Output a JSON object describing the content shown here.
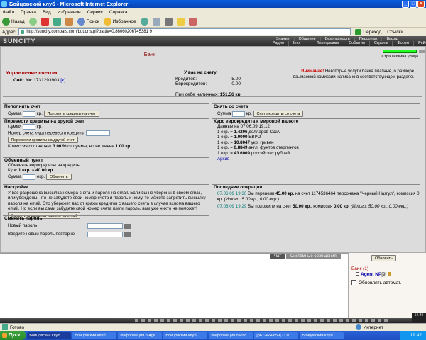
{
  "window": {
    "title": "Бойцовский клуб - Microsoft Internet Explorer"
  },
  "menu": [
    "Файл",
    "Правка",
    "Вид",
    "Избранное",
    "Сервис",
    "Справка"
  ],
  "toolbar": {
    "back": "Назад",
    "search": "Поиск",
    "favorites": "Избранное"
  },
  "address": {
    "label": "Адрес:",
    "url": "http://suncity.combats.com/buttons.pl?battle=0.86060206745381 9",
    "go": "Переход",
    "links": "Ссылки"
  },
  "game": {
    "logo": "SUNCITY",
    "nav_top": [
      "Знания",
      "Общение",
      "Безопасность",
      "Персонаж",
      "Выход"
    ],
    "nav_bottom": [
      "Радио",
      "Into история",
      "Телеграммы",
      "События",
      "Скролы",
      "Форум",
      "Рейтинг"
    ]
  },
  "bank": {
    "title": "Банк",
    "street_link": "Страшилкина улица",
    "account_title": "Управление счетом",
    "account_label": "Счёт №:",
    "account_number": "1731293903",
    "account_close": "[x]",
    "balance": {
      "header": "У вас на счету",
      "credits_label": "Кредитов:",
      "credits_value": "5.00",
      "eurocredits_label": "Еврокредитов:",
      "eurocredits_value": "0.00",
      "cash_label": "При себе наличных:",
      "cash_value": "151.56 кр."
    },
    "warning_bold": "Внимание!",
    "warning_text": "Некоторые услуги банка платные, о размере взымаемой комиссии написано в соответствующем разделе.",
    "deposit": {
      "title": "Пополнить счет",
      "sum_label": "Сумма",
      "unit": "кр.",
      "button": "Положить кредиты на счет"
    },
    "withdraw": {
      "title": "Снять со счета",
      "sum_label": "Сумма",
      "unit": "кр.",
      "button": "Снять кредиты со счета"
    },
    "transfer": {
      "title": "Перевести кредиты на другой счет",
      "sum_label": "Сумма",
      "unit": "кр.",
      "account_label": "Номер счета куда перевести кредиты",
      "button": "Перевести кредиты на другой счет",
      "commission_pre": "Комиссия составляет",
      "commission_pct": "3.00 %",
      "commission_mid": "от суммы, но не менее",
      "commission_min": "1.00 кр."
    },
    "rates": {
      "title": "Курс еврокредита к мировой валюте",
      "date": "Данные на 07.06.09 19:12",
      "rows": [
        {
          "lead": "1 екр. = ",
          "value": "1.4206",
          "cur": "долларов США"
        },
        {
          "lead": "1 екр. = ",
          "value": "1.0000",
          "cur": "ЕВРО"
        },
        {
          "lead": "1 екр. = ",
          "value": "10.8047",
          "cur": "укр. гривен"
        },
        {
          "lead": "1 екр. = ",
          "value": "0.8849",
          "cur": "англ. фунтов стерлингов"
        },
        {
          "lead": "1 екр. = ",
          "value": "43.6009",
          "cur": "российских рублей"
        }
      ],
      "archive": "Архив"
    },
    "exchange": {
      "title": "Обменный пункт",
      "desc": "Обменять еврокредиты на кредиты.",
      "rate_label": "Курс",
      "rate_value": "1 екр. = 40.00 кр.",
      "sum_label": "Сумма",
      "unit": "екр.",
      "button": "Обменять"
    },
    "settings": {
      "title": "Настройки",
      "text": "У вас разрешена высылка номера счета и пароля на email. Если вы не уверены в своем email, или убеждены, что не забудете свой номер счета и пароль к нему, то можете запретить высылку пароля на email. Это убережет вас от кражи кредитов с вашего счета в случае взлома вашего email. Но если вы сами забудете свой номер счета и/или пароль, вам уже никто не поможет!",
      "button": "Запретить высылку пароля на email"
    },
    "password": {
      "title": "Сменить пароль",
      "new_label": "Новый пароль",
      "repeat_label": "Введите новый пароль повторно"
    },
    "operations": {
      "title": "Последние операции",
      "items": [
        {
          "date": "07.06.09 19:30",
          "text_a": "Вы перевели",
          "amount": "45.00 кр.",
          "text_b": "на счет 1174536464 персонажа \"Черный Назгул\", комиссия",
          "fee": "0 кр.",
          "note": "(Итого: 5.00 кр., 0.00 екр.)"
        },
        {
          "date": "07.06.09 19:29",
          "text_a": "Вы положили на счет",
          "amount": "50.00 кр.",
          "text_b": ", комиссия",
          "fee": "0.00 кр.",
          "note": "(Итого: 50.00 кр., 0.00 екр.)"
        }
      ]
    }
  },
  "chat": {
    "tab_chat": "Чат",
    "tab_system": "Системные сообщения"
  },
  "side": {
    "refresh": "Обновить",
    "room": "Банк (1)",
    "agent": "Agent NP",
    "agent_level": "[9]",
    "auto_refresh": "Обновлять автомат."
  },
  "clock": "19:43",
  "status": {
    "ready": "Готово",
    "zone": "Интернет"
  },
  "taskbar": {
    "start": "Пуск",
    "tasks": [
      "Бойцовский клуб ...",
      "Бойцовский клуб ...",
      "Информация о Age...",
      "Бойцовский клуб ...",
      "Информация о Ran...",
      "[367-424-659] - Ок...",
      "Бойцовский клуб ..."
    ],
    "time": "19:42"
  }
}
